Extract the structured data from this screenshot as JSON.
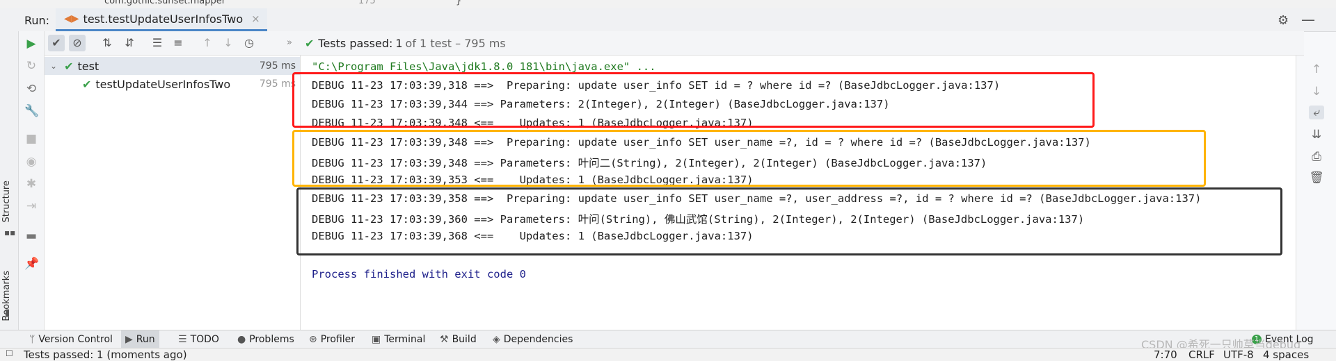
{
  "top_strip": {
    "path": "com.gothic.sunset.mapper",
    "line_no": "175",
    "brace": "}"
  },
  "run_header": {
    "label": "Run:",
    "tab_title": "test.testUpdateUserInfosTwo",
    "close": "×"
  },
  "left_sidebar": {
    "structure": "Structure",
    "bookmarks": "Bookmarks"
  },
  "status": {
    "text": "Tests passed:",
    "count": "1",
    "detail": "of 1 test – 795 ms"
  },
  "tree": {
    "root": {
      "label": "test",
      "time": "795 ms"
    },
    "child": {
      "label": "testUpdateUserInfosTwo",
      "time": "795 ms"
    }
  },
  "console": {
    "command": "\"C:\\Program Files\\Java\\jdk1.8.0_181\\bin\\java.exe\" ...",
    "lines": [
      "DEBUG 11-23 17:03:39,318 ==>  Preparing: update user_info SET id = ? where id =? (BaseJdbcLogger.java:137)",
      "DEBUG 11-23 17:03:39,344 ==> Parameters: 2(Integer), 2(Integer) (BaseJdbcLogger.java:137)",
      "DEBUG 11-23 17:03:39,348 <==    Updates: 1 (BaseJdbcLogger.java:137)",
      "DEBUG 11-23 17:03:39,348 ==>  Preparing: update user_info SET user_name =?, id = ? where id =? (BaseJdbcLogger.java:137)",
      "DEBUG 11-23 17:03:39,348 ==> Parameters: 叶问二(String), 2(Integer), 2(Integer) (BaseJdbcLogger.java:137)",
      "DEBUG 11-23 17:03:39,353 <==    Updates: 1 (BaseJdbcLogger.java:137)",
      "DEBUG 11-23 17:03:39,358 ==>  Preparing: update user_info SET user_name =?, user_address =?, id = ? where id =? (BaseJdbcLogger.java:137)",
      "DEBUG 11-23 17:03:39,360 ==> Parameters: 叶问(String), 佛山武馆(String), 2(Integer), 2(Integer) (BaseJdbcLogger.java:137)",
      "DEBUG 11-23 17:03:39,368 <==    Updates: 1 (BaseJdbcLogger.java:137)"
    ],
    "finished": "Process finished with exit code 0"
  },
  "bottom_tabs": [
    {
      "label": "Version Control",
      "icon": "branch-icon"
    },
    {
      "label": "Run",
      "icon": "play-icon"
    },
    {
      "label": "TODO",
      "icon": "list-icon"
    },
    {
      "label": "Problems",
      "icon": "info-icon"
    },
    {
      "label": "Profiler",
      "icon": "profiler-icon"
    },
    {
      "label": "Terminal",
      "icon": "terminal-icon"
    },
    {
      "label": "Build",
      "icon": "hammer-icon"
    },
    {
      "label": "Dependencies",
      "icon": "layers-icon"
    }
  ],
  "event_log": {
    "label": "Event Log",
    "badge": "1"
  },
  "status_bar": {
    "message": "Tests passed: 1 (moments ago)",
    "position": "7:70",
    "line_sep": "CRLF",
    "encoding": "UTF-8",
    "indent": "4 spaces"
  },
  "watermark": "CSDN @希死一只帅草当debug",
  "colors": {
    "box_red": "#ff1a1a",
    "box_orange": "#ffb400",
    "box_black": "#333333",
    "accent": "#4a86c7",
    "success": "#3aa04a"
  }
}
